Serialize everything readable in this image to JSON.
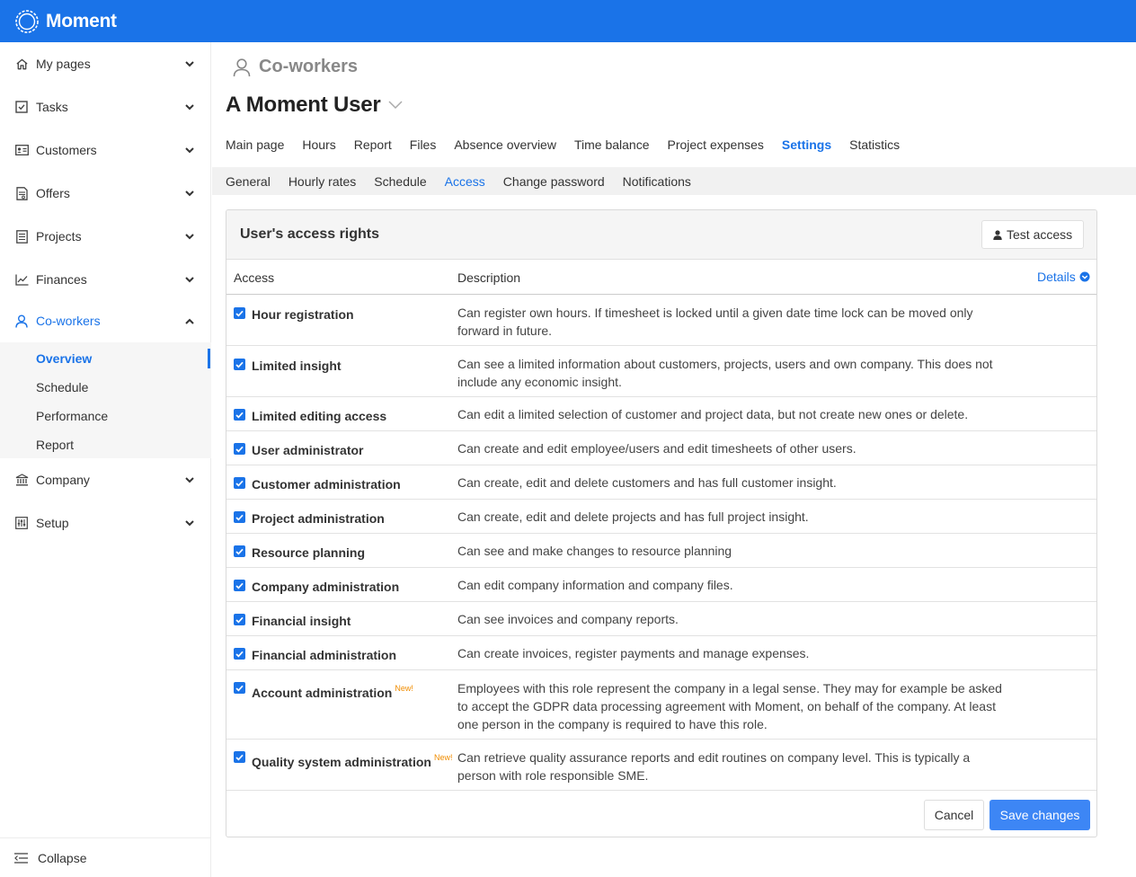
{
  "app": {
    "name": "Moment"
  },
  "sidebar": {
    "items": [
      {
        "label": "My pages",
        "icon": "home-icon"
      },
      {
        "label": "Tasks",
        "icon": "checkbox-icon"
      },
      {
        "label": "Customers",
        "icon": "id-card-icon"
      },
      {
        "label": "Offers",
        "icon": "document-icon"
      },
      {
        "label": "Projects",
        "icon": "clipboard-icon"
      },
      {
        "label": "Finances",
        "icon": "chart-line-icon"
      },
      {
        "label": "Co-workers",
        "icon": "user-icon"
      }
    ],
    "sub_items": [
      "Overview",
      "Schedule",
      "Performance",
      "Report"
    ],
    "items_after": [
      {
        "label": "Company",
        "icon": "bank-icon"
      },
      {
        "label": "Setup",
        "icon": "sliders-icon"
      }
    ],
    "collapse_label": "Collapse"
  },
  "section": {
    "title": "Co-workers"
  },
  "user": {
    "name": "A Moment User"
  },
  "tabs": [
    "Main page",
    "Hours",
    "Report",
    "Files",
    "Absence overview",
    "Time balance",
    "Project expenses",
    "Settings",
    "Statistics"
  ],
  "active_tab": "Settings",
  "subtabs": [
    "General",
    "Hourly rates",
    "Schedule",
    "Access",
    "Change password",
    "Notifications"
  ],
  "active_subtab": "Access",
  "panel": {
    "title": "User's access rights",
    "test_access_label": "Test access",
    "columns": {
      "access": "Access",
      "description": "Description"
    },
    "details_label": "Details",
    "rows": [
      {
        "name": "Hour registration",
        "desc": "Can register own hours. If timesheet is locked until a given date time lock can be moved only forward in future.",
        "checked": true,
        "new": ""
      },
      {
        "name": "Limited insight",
        "desc": "Can see a limited information about customers, projects, users and own company. This does not include any economic insight.",
        "checked": true,
        "new": ""
      },
      {
        "name": "Limited editing access",
        "desc": "Can edit a limited selection of customer and project data, but not create new ones or delete.",
        "checked": true,
        "new": ""
      },
      {
        "name": "User administrator",
        "desc": "Can create and edit employee/users and edit timesheets of other users.",
        "checked": true,
        "new": ""
      },
      {
        "name": "Customer administration",
        "desc": "Can create, edit and delete customers and has full customer insight.",
        "checked": true,
        "new": ""
      },
      {
        "name": "Project administration",
        "desc": "Can create, edit and delete projects and has full project insight.",
        "checked": true,
        "new": ""
      },
      {
        "name": "Resource planning",
        "desc": "Can see and make changes to resource planning",
        "checked": true,
        "new": ""
      },
      {
        "name": "Company administration",
        "desc": "Can edit company information and company files.",
        "checked": true,
        "new": ""
      },
      {
        "name": "Financial insight",
        "desc": "Can see invoices and company reports.",
        "checked": true,
        "new": ""
      },
      {
        "name": "Financial administration",
        "desc": "Can create invoices, register payments and manage expenses.",
        "checked": true,
        "new": ""
      },
      {
        "name": "Account administration",
        "desc": "Employees with this role represent the company in a legal sense. They may for example be asked to accept the GDPR data processing agreement with Moment, on behalf of the company. At least one person in the company is required to have this role.",
        "checked": true,
        "new": "New!"
      },
      {
        "name": "Quality system administration",
        "desc": "Can retrieve quality assurance reports and edit routines on company level. This is typically a person with role responsible SME.",
        "checked": true,
        "new": "New!"
      }
    ],
    "cancel_label": "Cancel",
    "save_label": "Save changes"
  },
  "colors": {
    "brand": "#1a73e8",
    "save_button": "#3d86f5",
    "new_badge": "#f08c00"
  }
}
